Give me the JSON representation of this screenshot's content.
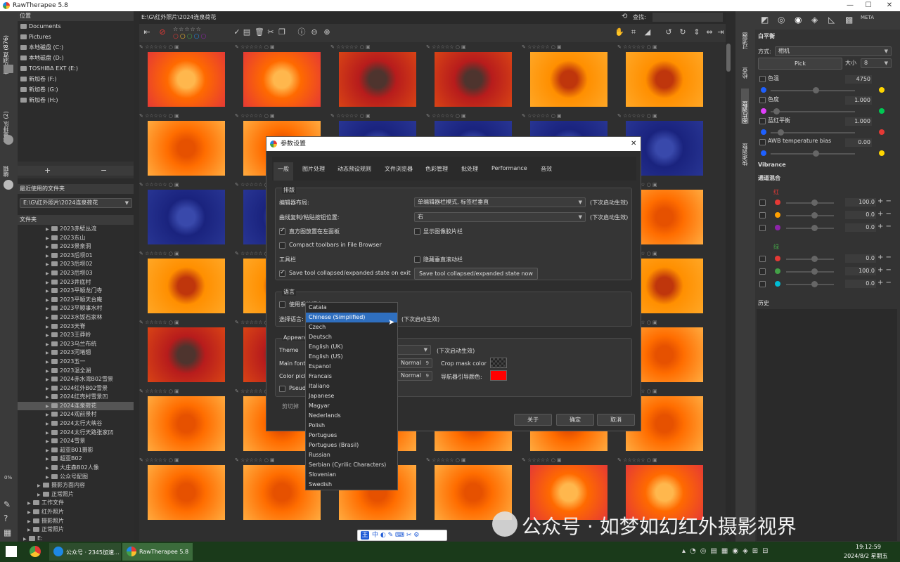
{
  "window": {
    "title": "RawTherapee 5.8"
  },
  "left_tabs": [
    "文件浏览 (876)",
    "批量排队 (2)",
    "编辑"
  ],
  "places": {
    "title": "位置",
    "items": [
      "Documents",
      "Pictures",
      "本地磁盘 (C:)",
      "本地磁盘 (D:)",
      "TOSHIBA EXT (E:)",
      "新加卷 (F:)",
      "新加卷 (G:)",
      "新加卷 (H:)"
    ],
    "add": "+",
    "remove": "−"
  },
  "recent": {
    "title": "最近使用的文件夹",
    "value": "E:\\G\\红外照片\\2024连泉荷花"
  },
  "folders": {
    "title": "文件夹",
    "items": [
      "2023赤壁丛流",
      "2023东山",
      "2023景泉洞",
      "2023后坝01",
      "2023后坝02",
      "2023后坝03",
      "2023井底村",
      "2023平顺龙门寺",
      "2023平顺天台庵",
      "2023平顺事水村",
      "2023水饭石家林",
      "2023天脊",
      "2023王莽岭",
      "2023乌兰布统",
      "2023河堵翘",
      "2023五一",
      "2023温全湖",
      "2024赤水湾B02雪景",
      "2024红外B02雪景",
      "2024红壳村雪景凹",
      "2024连泉荷花",
      "2024观前景村",
      "2024太行大峡谷",
      "2024太行天路张家凹",
      "2024雪景",
      "超亚B01摄影",
      "超亚B02",
      "大庄森B02人像",
      "公众号配图",
      "摄影方面内容",
      "正常照片",
      "工作文件",
      "红外照片",
      "摄影照片",
      "正常照片",
      "E:"
    ],
    "selected_index": 20
  },
  "left_percent": "0%",
  "path": {
    "value": "E:\\G\\红外照片\\2024连泉荷花",
    "search_label": "查找:"
  },
  "right_tabs": [
    "过滤器",
    "检查",
    "图片调整",
    "快速调整"
  ],
  "right_panel": {
    "white_balance": {
      "title": "白平衡",
      "method_label": "方式:",
      "method_value": "相机",
      "pick": "Pick",
      "size_label": "大小",
      "size_value": "8",
      "temp_label": "色温",
      "temp_value": "4750",
      "tint_label": "色度",
      "tint_value": "1.000",
      "blue_red_label": "蓝红平衡",
      "blue_red_value": "1.000",
      "awb_label": "AWB temperature bias",
      "awb_value": "0.00"
    },
    "vibrance": "Vibrance",
    "channel_mixer": "通道混合",
    "red_label": "红",
    "green_label": "绿",
    "red_values": [
      "100.0",
      "0.0",
      "0.0"
    ],
    "green_values": [
      "0.0",
      "100.0",
      "0.0"
    ],
    "history": "历史"
  },
  "dialog": {
    "title": "参数设置",
    "tabs": [
      "一般",
      "图片处理",
      "动态预设规则",
      "文件浏览器",
      "色彩管理",
      "批处理",
      "Performance",
      "音效"
    ],
    "layout": {
      "title": "排版",
      "editor_layout_label": "编辑器布局:",
      "editor_layout_value": "单编辑器栏模式, 标签栏垂直",
      "editor_note": "(下次启动生效)",
      "curve_label": "曲线复制/粘贴按钮位置:",
      "curve_value": "右",
      "curve_note": "(下次启动生效)",
      "hist_left": "直方图放置在左面板",
      "show_filmstrip": "显示图像胶片栏",
      "compact_toolbars": "Compact toolbars in File Browser",
      "toolbar_label": "工具栏",
      "hide_scrollbar": "隐藏垂直滚动栏",
      "save_state": "Save tool collapsed/expanded state on exit",
      "save_now": "Save tool collapsed/expanded state now"
    },
    "language": {
      "title": "语言",
      "use_system": "使用系统语言",
      "select_label": "选择语言:",
      "note": "(下次启动生效)"
    },
    "appearance": {
      "title": "Appearance",
      "theme_label": "Theme",
      "theme_note": "(下次启动生效)",
      "main_font_label": "Main font",
      "main_font_value": "Normal",
      "main_font_size": "9",
      "color_picker_label": "Color pick",
      "color_picker_value": "Normal",
      "color_picker_size": "9",
      "pseudo_label": "Pseud",
      "crop_mask_label": "Crop mask color",
      "nav_guide_label": "导航器引导颜色:",
      "nav_guide_color": "#ff0000",
      "cut_label": "剪切掉"
    },
    "buttons": {
      "about": "关于",
      "ok": "确定",
      "cancel": "取消"
    }
  },
  "languages": [
    "Catala",
    "Chinese (Simplified)",
    "Czech",
    "Deutsch",
    "English (UK)",
    "English (US)",
    "Espanol",
    "Francais",
    "Italiano",
    "Japanese",
    "Magyar",
    "Nederlands",
    "Polish",
    "Portugues",
    "Portugues (Brasil)",
    "Russian",
    "Serbian (Cyrilic Characters)",
    "Slovenian",
    "Swedish"
  ],
  "selected_language_index": 1,
  "watermark": "公众号 · 如梦如幻红外摄影视界",
  "taskbar": {
    "tasks": [
      "公众号 · 2345加速...",
      "RawTherapee 5.8"
    ],
    "time": "19:12:59",
    "date": "2024/8/2 星期五",
    "ime": "中"
  },
  "colors": {
    "accent": "#2f6fbf",
    "nav_guide": "#ff0000"
  }
}
